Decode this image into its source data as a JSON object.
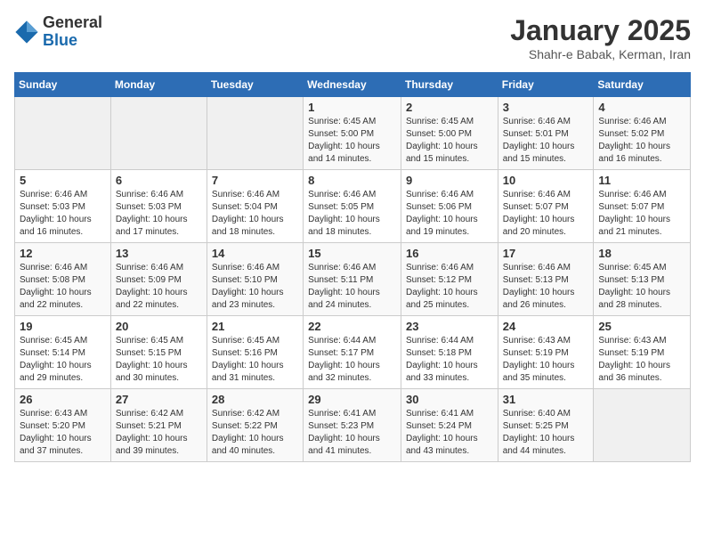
{
  "logo": {
    "general": "General",
    "blue": "Blue"
  },
  "title": "January 2025",
  "subtitle": "Shahr-e Babak, Kerman, Iran",
  "headers": [
    "Sunday",
    "Monday",
    "Tuesday",
    "Wednesday",
    "Thursday",
    "Friday",
    "Saturday"
  ],
  "weeks": [
    [
      {
        "day": "",
        "info": ""
      },
      {
        "day": "",
        "info": ""
      },
      {
        "day": "",
        "info": ""
      },
      {
        "day": "1",
        "info": "Sunrise: 6:45 AM\nSunset: 5:00 PM\nDaylight: 10 hours and 14 minutes."
      },
      {
        "day": "2",
        "info": "Sunrise: 6:45 AM\nSunset: 5:00 PM\nDaylight: 10 hours and 15 minutes."
      },
      {
        "day": "3",
        "info": "Sunrise: 6:46 AM\nSunset: 5:01 PM\nDaylight: 10 hours and 15 minutes."
      },
      {
        "day": "4",
        "info": "Sunrise: 6:46 AM\nSunset: 5:02 PM\nDaylight: 10 hours and 16 minutes."
      }
    ],
    [
      {
        "day": "5",
        "info": "Sunrise: 6:46 AM\nSunset: 5:03 PM\nDaylight: 10 hours and 16 minutes."
      },
      {
        "day": "6",
        "info": "Sunrise: 6:46 AM\nSunset: 5:03 PM\nDaylight: 10 hours and 17 minutes."
      },
      {
        "day": "7",
        "info": "Sunrise: 6:46 AM\nSunset: 5:04 PM\nDaylight: 10 hours and 18 minutes."
      },
      {
        "day": "8",
        "info": "Sunrise: 6:46 AM\nSunset: 5:05 PM\nDaylight: 10 hours and 18 minutes."
      },
      {
        "day": "9",
        "info": "Sunrise: 6:46 AM\nSunset: 5:06 PM\nDaylight: 10 hours and 19 minutes."
      },
      {
        "day": "10",
        "info": "Sunrise: 6:46 AM\nSunset: 5:07 PM\nDaylight: 10 hours and 20 minutes."
      },
      {
        "day": "11",
        "info": "Sunrise: 6:46 AM\nSunset: 5:07 PM\nDaylight: 10 hours and 21 minutes."
      }
    ],
    [
      {
        "day": "12",
        "info": "Sunrise: 6:46 AM\nSunset: 5:08 PM\nDaylight: 10 hours and 22 minutes."
      },
      {
        "day": "13",
        "info": "Sunrise: 6:46 AM\nSunset: 5:09 PM\nDaylight: 10 hours and 22 minutes."
      },
      {
        "day": "14",
        "info": "Sunrise: 6:46 AM\nSunset: 5:10 PM\nDaylight: 10 hours and 23 minutes."
      },
      {
        "day": "15",
        "info": "Sunrise: 6:46 AM\nSunset: 5:11 PM\nDaylight: 10 hours and 24 minutes."
      },
      {
        "day": "16",
        "info": "Sunrise: 6:46 AM\nSunset: 5:12 PM\nDaylight: 10 hours and 25 minutes."
      },
      {
        "day": "17",
        "info": "Sunrise: 6:46 AM\nSunset: 5:13 PM\nDaylight: 10 hours and 26 minutes."
      },
      {
        "day": "18",
        "info": "Sunrise: 6:45 AM\nSunset: 5:13 PM\nDaylight: 10 hours and 28 minutes."
      }
    ],
    [
      {
        "day": "19",
        "info": "Sunrise: 6:45 AM\nSunset: 5:14 PM\nDaylight: 10 hours and 29 minutes."
      },
      {
        "day": "20",
        "info": "Sunrise: 6:45 AM\nSunset: 5:15 PM\nDaylight: 10 hours and 30 minutes."
      },
      {
        "day": "21",
        "info": "Sunrise: 6:45 AM\nSunset: 5:16 PM\nDaylight: 10 hours and 31 minutes."
      },
      {
        "day": "22",
        "info": "Sunrise: 6:44 AM\nSunset: 5:17 PM\nDaylight: 10 hours and 32 minutes."
      },
      {
        "day": "23",
        "info": "Sunrise: 6:44 AM\nSunset: 5:18 PM\nDaylight: 10 hours and 33 minutes."
      },
      {
        "day": "24",
        "info": "Sunrise: 6:43 AM\nSunset: 5:19 PM\nDaylight: 10 hours and 35 minutes."
      },
      {
        "day": "25",
        "info": "Sunrise: 6:43 AM\nSunset: 5:19 PM\nDaylight: 10 hours and 36 minutes."
      }
    ],
    [
      {
        "day": "26",
        "info": "Sunrise: 6:43 AM\nSunset: 5:20 PM\nDaylight: 10 hours and 37 minutes."
      },
      {
        "day": "27",
        "info": "Sunrise: 6:42 AM\nSunset: 5:21 PM\nDaylight: 10 hours and 39 minutes."
      },
      {
        "day": "28",
        "info": "Sunrise: 6:42 AM\nSunset: 5:22 PM\nDaylight: 10 hours and 40 minutes."
      },
      {
        "day": "29",
        "info": "Sunrise: 6:41 AM\nSunset: 5:23 PM\nDaylight: 10 hours and 41 minutes."
      },
      {
        "day": "30",
        "info": "Sunrise: 6:41 AM\nSunset: 5:24 PM\nDaylight: 10 hours and 43 minutes."
      },
      {
        "day": "31",
        "info": "Sunrise: 6:40 AM\nSunset: 5:25 PM\nDaylight: 10 hours and 44 minutes."
      },
      {
        "day": "",
        "info": ""
      }
    ]
  ]
}
